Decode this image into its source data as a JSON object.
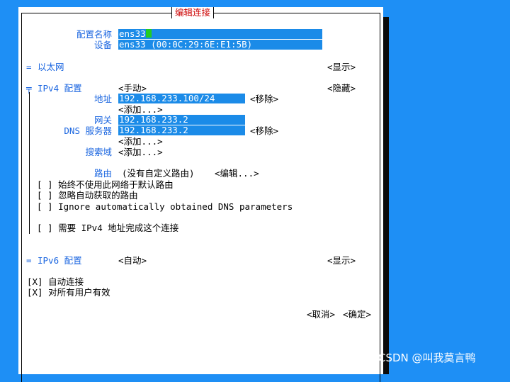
{
  "dialog": {
    "title": "编辑连接",
    "profile_name_label": "配置名称",
    "profile_name_value": "ens33",
    "device_label": "设备",
    "device_value": "ens33 (00:0C:29:6E:E1:5B)"
  },
  "ethernet": {
    "toggle_glyph": "=",
    "label": "以太网",
    "action": "<显示>"
  },
  "ipv4": {
    "toggle_glyph": "╤",
    "label": "IPv4 配置",
    "mode": "<手动>",
    "action": "<隐藏>",
    "address_label": "地址",
    "address_value": "192.168.233.100/24",
    "remove_label": "<移除>",
    "add_label": "<添加...>",
    "gateway_label": "网关",
    "gateway_value": "192.168.233.2",
    "dns_label": "DNS 服务器",
    "dns_value": "192.168.233.2",
    "dns_remove_label": "<移除>",
    "dns_add_label": "<添加...>",
    "search_domains_label": "搜索域",
    "search_add_label": "<添加...>",
    "routing_label": "路由",
    "routing_value": "(没有自定义路由)",
    "routing_edit_label": "<编辑...>",
    "checkboxes": [
      {
        "mark": "[ ]",
        "label": "始终不使用此网络于默认路由"
      },
      {
        "mark": "[ ]",
        "label": "忽略自动获取的路由"
      },
      {
        "mark": "[ ]",
        "label": "Ignore automatically obtained DNS parameters"
      },
      {
        "mark": "[ ]",
        "label": "需要 IPv4 地址完成这个连接"
      }
    ]
  },
  "ipv6": {
    "toggle_glyph": "=",
    "label": "IPv6 配置",
    "mode": "<自动>",
    "action": "<显示>"
  },
  "options": [
    {
      "mark": "[X]",
      "label": "自动连接"
    },
    {
      "mark": "[X]",
      "label": "对所有用户有效"
    }
  ],
  "footer": {
    "cancel_label": "<取消>",
    "ok_label": "<确定>"
  },
  "watermark": "CSDN @叫我莫言鸭",
  "colors": {
    "background": "#1e8ff5",
    "field_fill": "#1b8be8",
    "label_blue": "#1b66e0",
    "title_red": "#cc0000",
    "cursor_green": "#22cc22"
  }
}
